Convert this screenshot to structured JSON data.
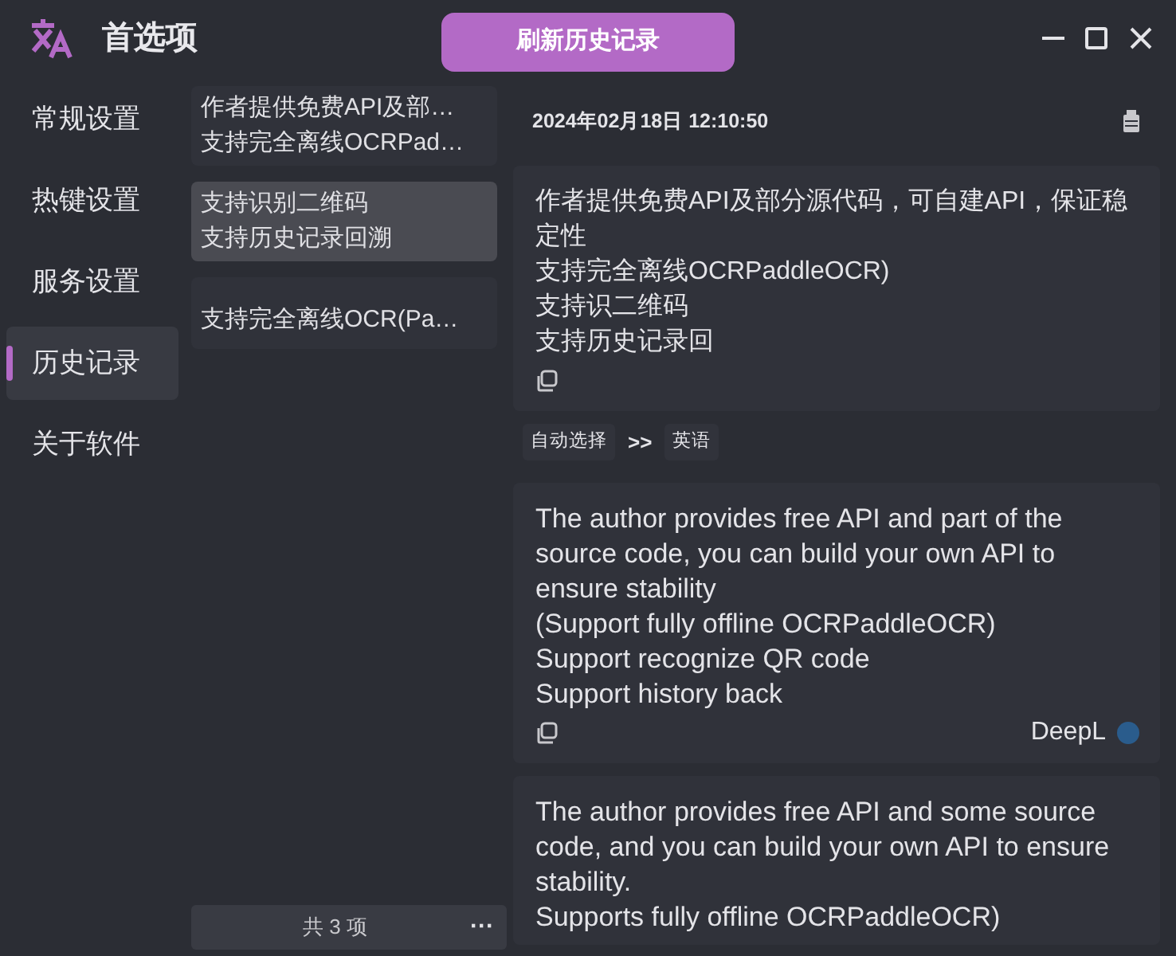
{
  "window": {
    "title": "首选项",
    "refresh_button": "刷新历史记录"
  },
  "sidebar": {
    "items": [
      {
        "label": "常规设置",
        "selected": false
      },
      {
        "label": "热键设置",
        "selected": false
      },
      {
        "label": "服务设置",
        "selected": false
      },
      {
        "label": "历史记录",
        "selected": true
      },
      {
        "label": "关于软件",
        "selected": false
      }
    ]
  },
  "history": {
    "items": [
      {
        "lines": [
          "作者提供免费API及部…",
          "支持完全离线OCRPad…"
        ],
        "selected": false
      },
      {
        "lines": [
          "支持识别二维码",
          "支持历史记录回溯"
        ],
        "selected": true
      },
      {
        "lines": [
          "支持完全离线OCR(Pa…"
        ],
        "selected": false
      }
    ],
    "count": "共 3 项",
    "more": "···"
  },
  "detail": {
    "timestamp": "2024年02月18日 12:10:50",
    "source_text": [
      "作者提供免费API及部分源代码，可自建API，保证稳定性",
      "支持完全离线OCRPaddleOCR)",
      "支持识二维码",
      "支持历史记录回"
    ],
    "source_language": "自动选择",
    "arrow": ">>",
    "target_language": "英语",
    "translations": [
      {
        "lines": [
          "The author provides free API and part of the source code, you can build your own API to ensure stability",
          "(Support fully offline OCRPaddleOCR)",
          "Support recognize QR code",
          "Support history back"
        ],
        "service": "DeepL"
      },
      {
        "lines": [
          "The author provides free API and some source code, and you can build your own API to ensure stability.",
          "Supports fully offline OCRPaddleOCR)"
        ]
      }
    ]
  }
}
